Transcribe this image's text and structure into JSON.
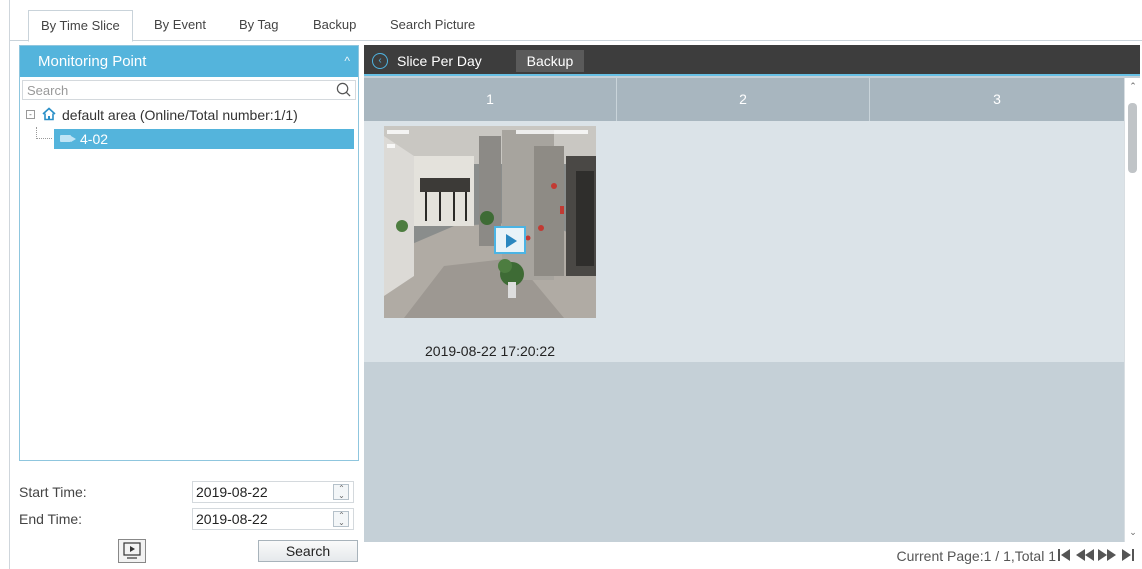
{
  "tabs": [
    {
      "label": "By Time Slice",
      "active": true
    },
    {
      "label": "By Event",
      "active": false
    },
    {
      "label": "By Tag",
      "active": false
    },
    {
      "label": "Backup",
      "active": false
    },
    {
      "label": "Search Picture",
      "active": false
    }
  ],
  "monitoring": {
    "title": "Monitoring Point",
    "collapse_glyph": "^",
    "search_placeholder": "Search",
    "tree": {
      "root_label": "default area (Online/Total number:1/1)",
      "expander": "-",
      "children": [
        {
          "label": "4-02",
          "selected": true
        }
      ]
    }
  },
  "filters": {
    "start_label": "Start Time:",
    "start_value": "2019-08-22",
    "end_label": "End Time:",
    "end_value": "2019-08-22",
    "search_button": "Search"
  },
  "toolbar": {
    "slice_label": "Slice Per Day",
    "backup_button": "Backup"
  },
  "grid": {
    "columns": [
      "1",
      "2",
      "3"
    ],
    "items": [
      {
        "caption": "2019-08-22 17:20:22"
      }
    ]
  },
  "pager": {
    "text": "Current Page:1 / 1,Total 1"
  },
  "colors": {
    "accent": "#54b4dc",
    "toolbar_bg": "#3d3d3d",
    "grid_header": "#a8b6bf",
    "grid_row": "#dbe3e8"
  }
}
